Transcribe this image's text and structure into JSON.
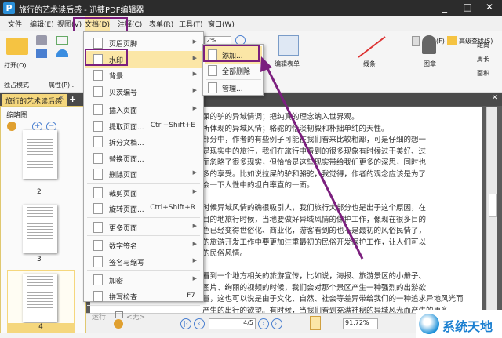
{
  "window": {
    "title": "旅行的艺术读后感 - 迅捷PDF编辑器",
    "logo": "P",
    "controls": [
      "_",
      "□",
      "✕"
    ]
  },
  "menubar": [
    "文件",
    "编辑(E)",
    "视图(V)",
    "文档(D)",
    "注释(C)",
    "表单(R)",
    "工具(T)",
    "窗口(W)"
  ],
  "ribbon": {
    "open": "打开(O)...",
    "exclusive_mode": "独占模式",
    "properties": "属性(P)...",
    "zoom": "2%",
    "find": "查找(F)",
    "advanced_find": "高级查找(S)",
    "edit_form": "编辑表单",
    "lines": "线条",
    "stamp": "图章",
    "distance": "距离",
    "perimeter": "周长",
    "area": "面积"
  },
  "tab": {
    "label": "旅行的艺术读后感",
    "close": "×",
    "add": "+"
  },
  "left_panel": {
    "title": "缩略图",
    "pages": [
      "2",
      "3",
      "4"
    ],
    "selected": "4"
  },
  "doc_menu": {
    "items": [
      {
        "label": "页眉页脚",
        "arrow": true
      },
      {
        "label": "水印",
        "arrow": true,
        "highlighted": true
      },
      {
        "label": "背景",
        "arrow": true
      },
      {
        "label": "贝茨编号",
        "arrow": true
      },
      {
        "label": "插入页面",
        "arrow": true
      },
      {
        "label": "提取页面...",
        "shortcut": "Ctrl+Shift+E"
      },
      {
        "label": "拆分文档..."
      },
      {
        "label": "替换页面..."
      },
      {
        "label": "删除页面",
        "arrow": true
      },
      {
        "label": "裁剪页面",
        "arrow": true
      },
      {
        "label": "旋转页面...",
        "shortcut": "Ctrl+Shift+R"
      },
      {
        "label": "更多页面",
        "arrow": true
      },
      {
        "label": "数字签名",
        "arrow": true
      },
      {
        "label": "签名与缩写",
        "arrow": true
      },
      {
        "label": "加密",
        "arrow": true
      },
      {
        "label": "拼写检查",
        "shortcut": "F7"
      }
    ],
    "run_label": "运行:",
    "run_value": "<无>"
  },
  "submenu": {
    "items": [
      "添加...",
      "全部删除",
      "管理..."
    ]
  },
  "document": {
    "lines": [
      "屎的驴的异域情调；把纯真的理念纳入世界观。",
      "所体现的异域风情；骆驼的恬淡韧毅和朴拙单纯的天性。",
      "部分中，作者的有些例子可能在我们看来比较粗鄙，可是仔细的想一",
      "是现实中的旅行，我们在旅行中看到的很多现象有时候过于美好、过",
      "而忽略了很多现实，但恰恰是这些现实带给我们更多的深思，同时也",
      "多的享受。比如说拉屎的驴和骆驼，我觉得，作者的观念应该是为了",
      "会一下人性中的坦白率直的一面。",
      "",
      "时候异域风情的确很吸引人，我们旅行大部分也是出于这个原因，在",
      "目的地旅行时候，当地要做好异域风情的保护工作，像现在很多目的",
      "色已经变得世俗化、商业化，游客看到的也不是最初的风俗民情了，",
      "的旅游开发工作中要更加注重最初的民俗开发保护工作，让人们可以",
      "的民俗风情。",
      "",
      "看到一个地方相关的旅游宣传，比如说，海报、旅游景区的小册子、",
      "图片、绚丽的视频的时候，我们会对那个景区产生一种强烈的出游欲",
      "量，这也可以说是由于文化、自然、社会等差异带给我们的一种追求异地风光而",
      "产生的出行的欲望。有时候，当我们看到充满神秘的异域风光而产生的更多"
    ]
  },
  "statusbar": {
    "page": "4",
    "total": "/5",
    "zoom": "91.72%"
  },
  "watermark_logo": "系统天地",
  "colors": {
    "annotation": "#7b1f7e",
    "highlight": "#fbe6a6",
    "tab": "#f5d77d"
  }
}
